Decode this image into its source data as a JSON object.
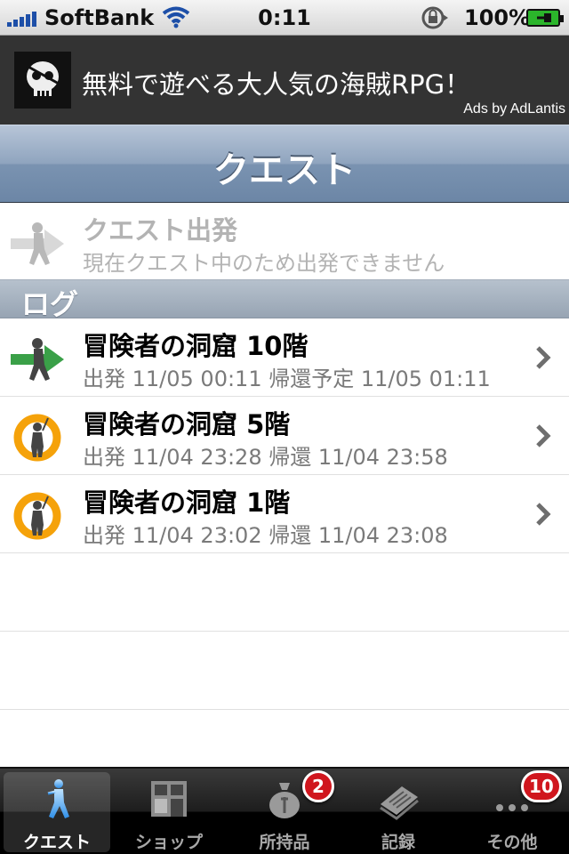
{
  "status_bar": {
    "carrier": "SoftBank",
    "time": "0:11",
    "battery": "100%"
  },
  "ad": {
    "text": "無料で遊べる大人気の海賊RPG！",
    "credit": "Ads by AdLantis"
  },
  "nav": {
    "title": "クエスト"
  },
  "start_quest": {
    "title": "クエスト出発",
    "subtitle": "現在クエスト中のため出発できません"
  },
  "log": {
    "header": "ログ",
    "items": [
      {
        "title": "冒険者の洞窟 10階",
        "subtitle": "出発 11/05 00:11 帰還予定 11/05 01:11",
        "status": "in-progress"
      },
      {
        "title": "冒険者の洞窟 5階",
        "subtitle": "出発 11/04 23:28 帰還 11/04 23:58",
        "status": "returned"
      },
      {
        "title": "冒険者の洞窟 1階",
        "subtitle": "出発 11/04 23:02 帰還 11/04 23:08",
        "status": "returned"
      }
    ]
  },
  "tabs": [
    {
      "label": "クエスト",
      "icon": "adventurer-icon",
      "active": true
    },
    {
      "label": "ショップ",
      "icon": "shop-icon"
    },
    {
      "label": "所持品",
      "icon": "bag-icon",
      "badge": "2"
    },
    {
      "label": "記録",
      "icon": "records-icon"
    },
    {
      "label": "その他",
      "icon": "more-icon",
      "badge": "10"
    }
  ],
  "colors": {
    "nav_gradient": "#7a93b1",
    "arrow_green": "#3aa048",
    "returned_orange": "#f5a20a",
    "badge_red": "#d0161e"
  }
}
